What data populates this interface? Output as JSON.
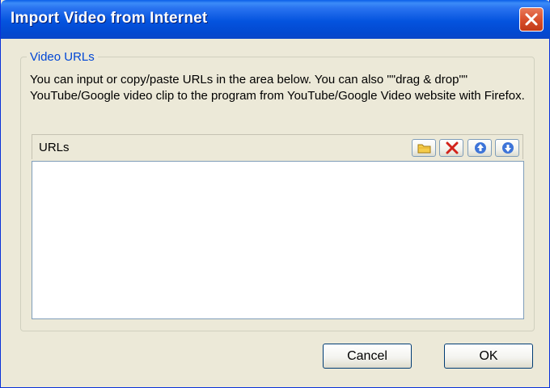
{
  "window": {
    "title": "Import Video from Internet"
  },
  "group": {
    "label": "Video URLs",
    "description": "You can input or copy/paste URLs in the area below. You can also \"\"drag & drop\"\" YouTube/Google video clip to the program from YouTube/Google Video website with Firefox."
  },
  "urls": {
    "header": "URLs",
    "value": "",
    "toolbar": [
      {
        "name": "open-folder-button",
        "icon": "folder-icon"
      },
      {
        "name": "delete-button",
        "icon": "red-x-icon"
      },
      {
        "name": "move-up-button",
        "icon": "arrow-up-icon"
      },
      {
        "name": "move-down-button",
        "icon": "arrow-down-icon"
      }
    ]
  },
  "buttons": {
    "cancel": "Cancel",
    "ok": "OK"
  },
  "colors": {
    "titlebar": "#0453de",
    "group_label": "#0046d5",
    "close": "#d9502d",
    "dialog_bg": "#ece9d8"
  }
}
